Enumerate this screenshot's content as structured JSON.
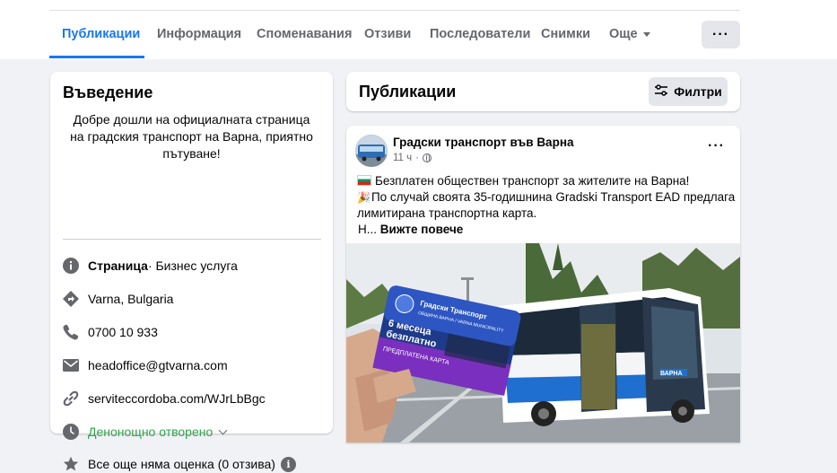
{
  "tabs": [
    {
      "label": "Публикации",
      "active": true
    },
    {
      "label": "Информация"
    },
    {
      "label": "Споменавания"
    },
    {
      "label": "Отзиви"
    },
    {
      "label": "Последователи"
    },
    {
      "label": "Снимки"
    },
    {
      "label": "Още"
    }
  ],
  "more_button_icon": "more-dots-icon",
  "intro": {
    "title": "Въведение",
    "text": "Добре дошли на официалната страница на градския транспорт на Варна, приятно пътуване!",
    "category_strong": "Страница",
    "category_rest": " · Бизнес услуга",
    "address": "Varna, Bulgaria",
    "phone": "0700 10 933",
    "email": "headoffice@gtvarna.com",
    "website": "serviteccordoba.com/WJrLbBgc",
    "hours": "Денонощно отворено",
    "rating": "Все още няма оценка (0 отзива)"
  },
  "publications": {
    "title": "Публикации",
    "filter_label": "Филтри"
  },
  "post": {
    "page_name": "Градски транспорт във Варна",
    "time": "11 ч",
    "line1": "Безплатен обществен транспорт за жителите на Варна!",
    "line2": "По случай своята 35-годишнина Gradski Transport EAD предлага",
    "line3": "лимитирана транспортна карта.",
    "line4_prefix": "Н... ",
    "see_more": "Вижте повече",
    "card_text1": "Градски Транспорт",
    "card_text2": "ОБЩИНА ВАРНА / VARNA MUNICIPALITY",
    "card_text3": "6 месеца",
    "card_text4": "безплатно",
    "card_text5": "ПРЕДПЛАТЕНА КАРТА",
    "bus_sign": "ВАРНА"
  },
  "colors": {
    "accent": "#1877f2",
    "green": "#31a24c",
    "muted": "#65676b"
  }
}
